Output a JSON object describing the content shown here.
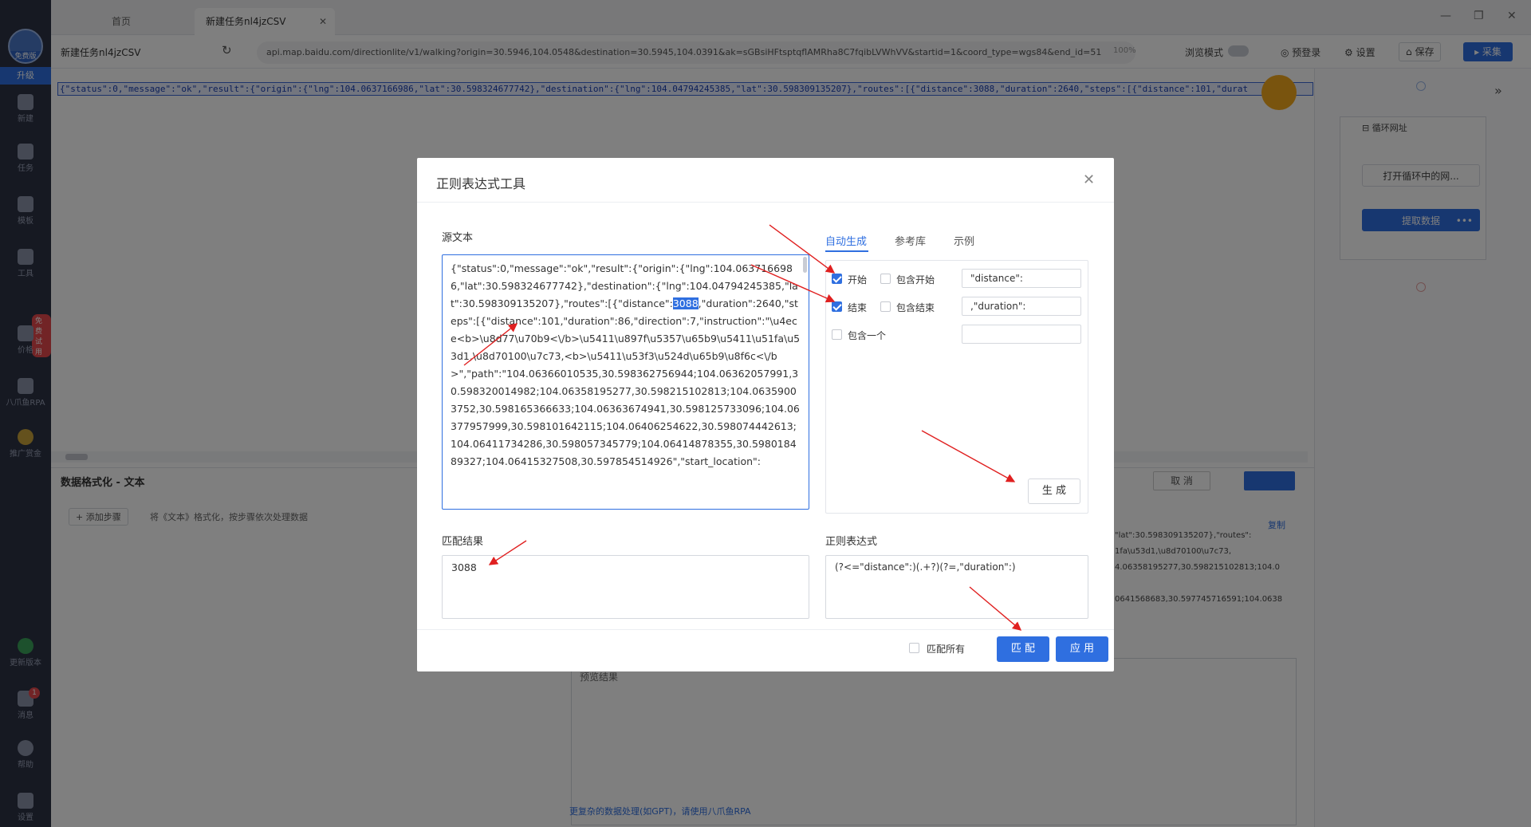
{
  "rail": {
    "edition": "免费版",
    "upgrade": "升级",
    "items": [
      "新建",
      "任务",
      "模板",
      "工具",
      "价格",
      "八爪鱼RPA",
      "推广赏金",
      "更新版本",
      "消息",
      "帮助",
      "设置"
    ],
    "trial_badge": "免费试用",
    "msg_count": "1"
  },
  "tabs": {
    "home": "首页",
    "current": "新建任务nl4jzCSV"
  },
  "toolbar": {
    "task_name": "新建任务nl4jzCSV",
    "url": "api.map.baidu.com/directionlite/v1/walking?origin=30.5946,104.0548&destination=30.5945,104.0391&ak=sGBsiHFtsptqflAMRha8C7fqibLVWhVV&startid=1&coord_type=wgs84&end_id=51",
    "zoom": "100%",
    "browse_mode": "浏览模式",
    "prelogin": "预登录",
    "settings": "设置",
    "save": "保存",
    "collect": "采集"
  },
  "page": {
    "json_line": "{\"status\":0,\"message\":\"ok\",\"result\":{\"origin\":{\"lng\":104.0637166986,\"lat\":30.598324677742},\"destination\":{\"lng\":104.04794245385,\"lat\":30.598309135207},\"routes\":[{\"distance\":3088,\"duration\":2640,\"steps\":[{\"distance\":101,\"durat"
  },
  "flow": {
    "loop": "循环网址",
    "open": "打开循环中的网...",
    "extract": "提取数据"
  },
  "format_panel": {
    "title": "数据格式化 - 文本",
    "add_step": "+ 添加步骤",
    "hint": "将《文本》格式化，按步骤依次处理数据",
    "cancel": "取 消",
    "copy": "复制",
    "rhs_lines": [
      "\"lat\":30.598309135207},\"routes\":",
      "1fa\\u53d1,\\u8d70100\\u7c73,",
      "4.06358195277,30.598215102813;104.0",
      "",
      "0641568683,30.597745716591;104.0638"
    ],
    "preview": "预览结果",
    "gpt_link": "更复杂的数据处理(如GPT)，请使用八爪鱼RPA"
  },
  "dialog": {
    "title": "正则表达式工具",
    "source_label": "源文本",
    "source_before": "{\"status\":0,\"message\":\"ok\",\"result\":{\"origin\":{\"lng\":104.0637166986,\"lat\":30.598324677742},\"destination\":{\"lng\":104.04794245385,\"lat\":30.598309135207},\"routes\":[{\"distance\":",
    "source_highlight": "3088",
    "source_after": ",\"duration\":2640,\"steps\":[{\"distance\":101,\"duration\":86,\"direction\":7,\"instruction\":\"\\u4ece<b>\\u8d77\\u70b9<\\/b>\\u5411\\u897f\\u5357\\u65b9\\u5411\\u51fa\\u53d1,\\u8d70100\\u7c73,<b>\\u5411\\u53f3\\u524d\\u65b9\\u8f6c<\\/b>\",\"path\":\"104.06366010535,30.598362756944;104.06362057991,30.598320014982;104.06358195277,30.598215102813;104.06359003752,30.598165366633;104.06363674941,30.598125733096;104.06377957999,30.598101642115;104.06406254622,30.598074442613;104.06411734286,30.598057345779;104.06414878355,30.598018489327;104.06415327508,30.597854514926\",\"start_location\":",
    "tabs": [
      "自动生成",
      "参考库",
      "示例"
    ],
    "opt_start": "开始",
    "opt_include_start": "包含开始",
    "opt_end": "结束",
    "opt_include_end": "包含结束",
    "opt_include_one": "包含一个",
    "start_value": "\"distance\":",
    "end_value": ",\"duration\":",
    "one_value": "",
    "generate": "生 成",
    "match_label": "匹配结果",
    "match_value": "3088",
    "regex_label": "正则表达式",
    "regex_value": "(?<=\"distance\":)(.+?)(?=,\"duration\":)",
    "match_all": "匹配所有",
    "match_btn": "匹 配",
    "apply_btn": "应 用"
  },
  "colors": {
    "accent": "#2f6fe0",
    "arrow": "#e02020",
    "rail": "#2d3245"
  }
}
